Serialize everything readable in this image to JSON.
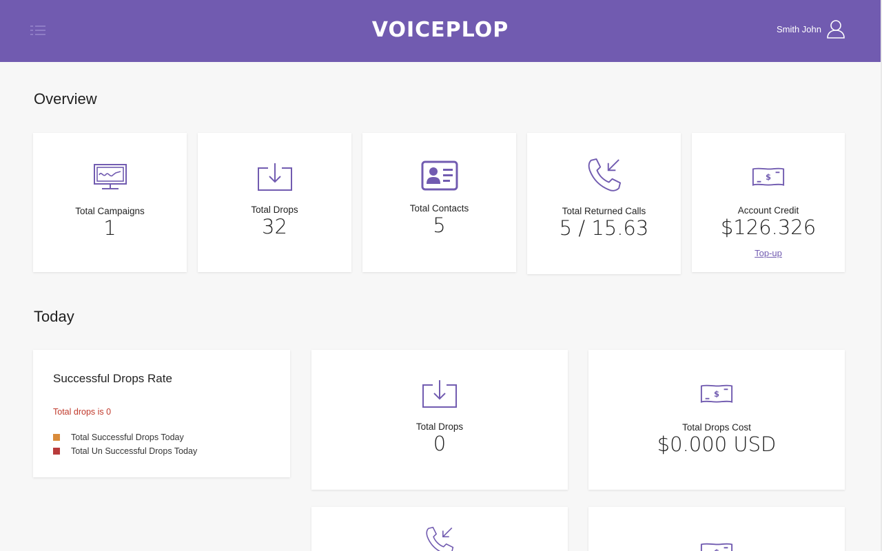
{
  "header": {
    "logo": "VOICEPLOP",
    "user_name": "Smith John",
    "bg_color": "#715bb0",
    "menu_icon": "list-menu-icon",
    "user_icon": "user-icon"
  },
  "overview": {
    "title": "Overview",
    "cards": [
      {
        "label": "Total Campaigns",
        "value": "1",
        "icon": "monitor-chart-icon"
      },
      {
        "label": "Total Drops",
        "value": "32",
        "icon": "download-tray-icon"
      },
      {
        "label": "Total Contacts",
        "value": "5",
        "icon": "contact-card-icon"
      },
      {
        "label": "Total Returned Calls",
        "value": "5 / 15.63",
        "icon": "incoming-call-icon"
      },
      {
        "label": "Account Credit",
        "value": "$126.326",
        "icon": "banknote-icon",
        "link": "Top-up"
      }
    ]
  },
  "today": {
    "title": "Today",
    "rate": {
      "title": "Successful Drops Rate",
      "error": "Total drops is 0",
      "legend": [
        {
          "label": "Total Successful Drops Today",
          "color": "#d98b3a"
        },
        {
          "label": "Total Un Successful Drops Today",
          "color": "#b83b3b"
        }
      ]
    },
    "drops": {
      "label": "Total Drops",
      "value": "0",
      "icon": "download-tray-icon"
    },
    "cost": {
      "label": "Total Drops Cost",
      "value": "$0.000 USD",
      "icon": "banknote-icon"
    },
    "lower_icons": [
      "incoming-call-icon",
      "banknote-icon"
    ]
  },
  "accent_color": "#715bb0"
}
